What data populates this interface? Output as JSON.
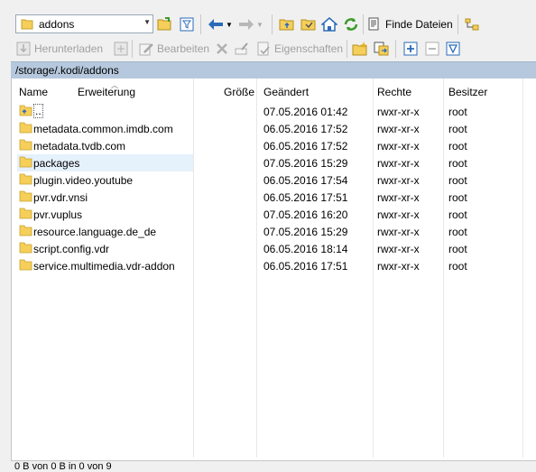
{
  "toolbar": {
    "location_value": "addons",
    "find_files_label": "Finde Dateien"
  },
  "toolbar2": {
    "download_label": "Herunterladen",
    "edit_label": "Bearbeiten",
    "properties_label": "Eigenschaften"
  },
  "path": "/storage/.kodi/addons",
  "columns": {
    "name": "Name",
    "extension": "Erweiterung",
    "size": "Größe",
    "changed": "Geändert",
    "rights": "Rechte",
    "owner": "Besitzer"
  },
  "rows": [
    {
      "name": "..",
      "changed": "07.05.2016 01:42",
      "rights": "rwxr-xr-x",
      "owner": "root",
      "icon": "parent-folder-icon"
    },
    {
      "name": "metadata.common.imdb.com",
      "changed": "06.05.2016 17:52",
      "rights": "rwxr-xr-x",
      "owner": "root",
      "icon": "folder-icon"
    },
    {
      "name": "metadata.tvdb.com",
      "changed": "06.05.2016 17:52",
      "rights": "rwxr-xr-x",
      "owner": "root",
      "icon": "folder-icon"
    },
    {
      "name": "packages",
      "changed": "07.05.2016 15:29",
      "rights": "rwxr-xr-x",
      "owner": "root",
      "icon": "folder-icon"
    },
    {
      "name": "plugin.video.youtube",
      "changed": "06.05.2016 17:54",
      "rights": "rwxr-xr-x",
      "owner": "root",
      "icon": "folder-icon"
    },
    {
      "name": "pvr.vdr.vnsi",
      "changed": "06.05.2016 17:51",
      "rights": "rwxr-xr-x",
      "owner": "root",
      "icon": "folder-icon"
    },
    {
      "name": "pvr.vuplus",
      "changed": "07.05.2016 16:20",
      "rights": "rwxr-xr-x",
      "owner": "root",
      "icon": "folder-icon"
    },
    {
      "name": "resource.language.de_de",
      "changed": "07.05.2016 15:29",
      "rights": "rwxr-xr-x",
      "owner": "root",
      "icon": "folder-icon"
    },
    {
      "name": "script.config.vdr",
      "changed": "06.05.2016 18:14",
      "rights": "rwxr-xr-x",
      "owner": "root",
      "icon": "folder-icon"
    },
    {
      "name": "service.multimedia.vdr-addon",
      "changed": "06.05.2016 17:51",
      "rights": "rwxr-xr-x",
      "owner": "root",
      "icon": "folder-icon"
    }
  ],
  "selected_row": "packages",
  "status": "0 B von 0 B in 0 von 9",
  "colors": {
    "path_bar": "#b6c8dd",
    "folder": "#f5cf5a",
    "selection": "#e5f1fb",
    "accent_blue": "#2a6ab8",
    "accent_green": "#3a9a2a"
  }
}
